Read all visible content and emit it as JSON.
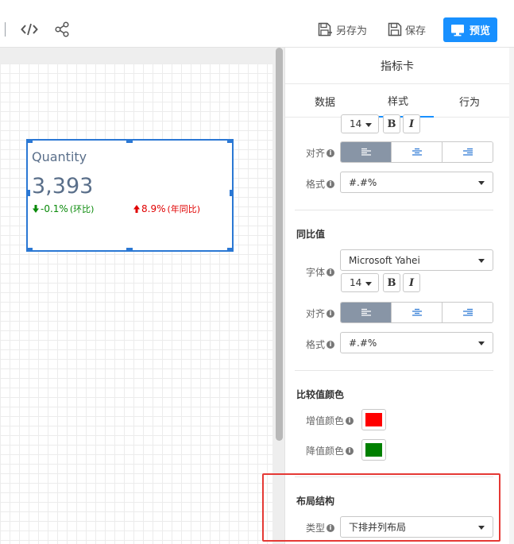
{
  "toolbar": {
    "save_as_label": "另存为",
    "save_label": "保存",
    "preview_label": "预览"
  },
  "card": {
    "title": "Quantity",
    "value": "3,393",
    "mom_value": "-0.1%",
    "mom_suffix": "(环比)",
    "yoy_value": "8.9%",
    "yoy_suffix": "(年同比)"
  },
  "panel": {
    "title": "指标卡",
    "tabs": [
      {
        "label": "数据"
      },
      {
        "label": "样式"
      },
      {
        "label": "行为"
      }
    ],
    "top_section": {
      "size_value": "14",
      "align_label": "对齐",
      "format_label": "格式",
      "format_value": "#.#%"
    },
    "compare_section": {
      "title": "同比值",
      "font_label": "字体",
      "font_value": "Microsoft Yahei",
      "size_value": "14",
      "align_label": "对齐",
      "format_label": "格式",
      "format_value": "#.#%"
    },
    "color_section": {
      "title": "比较值颜色",
      "increase_label": "增值颜色",
      "increase_color": "#ff0000",
      "decrease_label": "降值颜色",
      "decrease_color": "#008000"
    },
    "layout_section": {
      "title": "布局结构",
      "type_label": "类型",
      "type_value": "下排并列布局"
    },
    "bold_label": "B",
    "italic_label": "I"
  },
  "colors": {
    "accent": "#1890ff",
    "selection": "#2b78d4",
    "highlight_box": "#e53935",
    "increase": "#e00000",
    "decrease": "#0a8a0a"
  }
}
